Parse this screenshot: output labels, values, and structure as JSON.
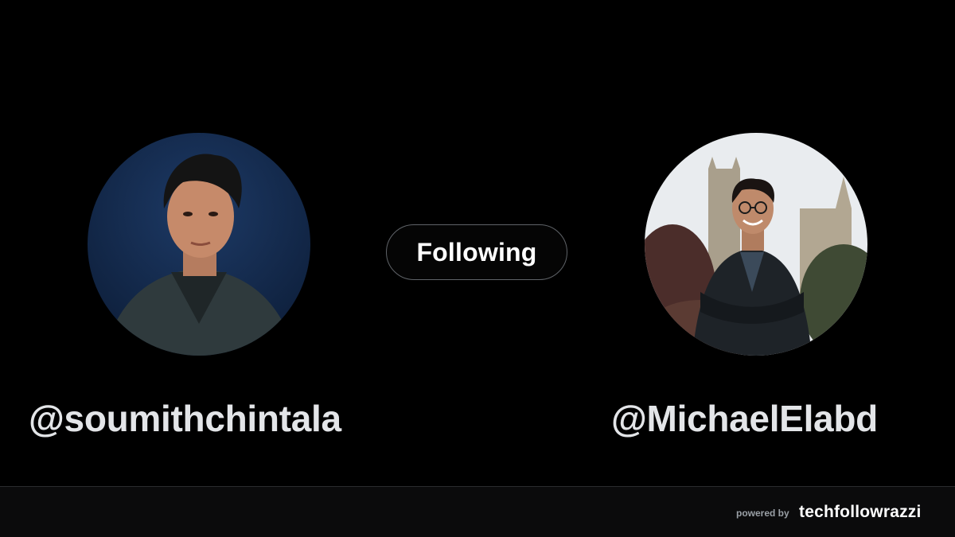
{
  "follow_card": {
    "relation_label": "Following",
    "follower": {
      "handle": "@soumithchintala",
      "avatar": "profile-photo"
    },
    "followed": {
      "handle": "@MichaelElabd",
      "avatar": "profile-photo"
    }
  },
  "footer": {
    "powered_by": "powered by",
    "brand": "techfollowrazzi"
  },
  "colors": {
    "background": "#000000",
    "footer_background": "#0b0b0c",
    "handle_text": "#e3e5e8",
    "pill_border": "#5f6368"
  }
}
